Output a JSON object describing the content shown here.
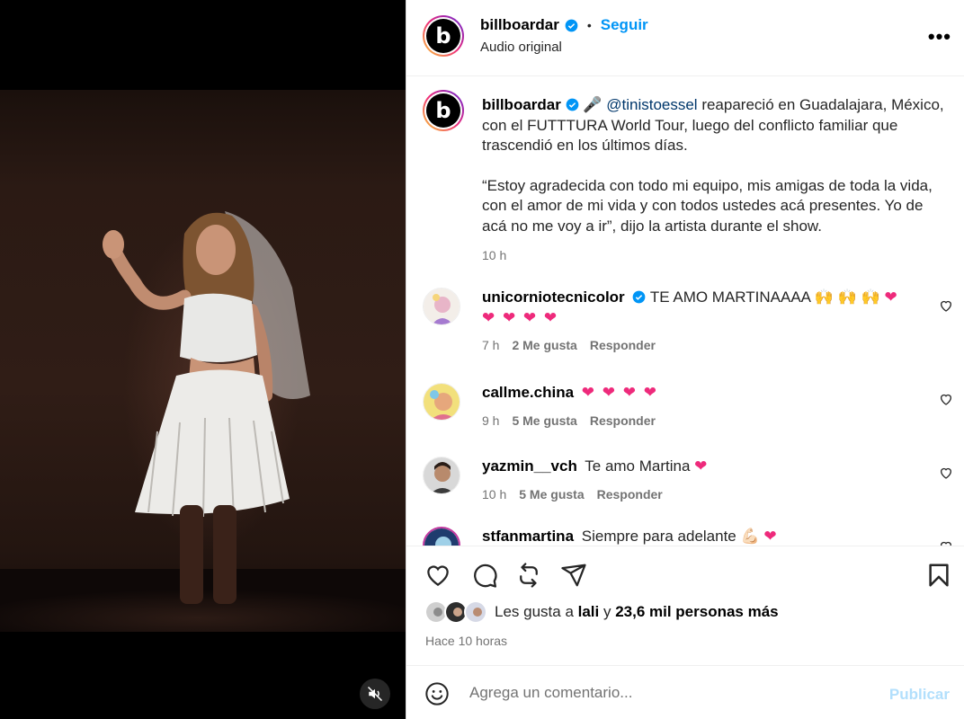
{
  "post": {
    "author": "billboardar",
    "author_avatar_letter": "b",
    "header_subtitle": "Audio original",
    "follow_label": "Seguir",
    "more_label": "•••",
    "caption": {
      "mention": "@tinistoessel",
      "text_1": " reapareció en Guadalajara, México, con el FUTTTURA World Tour, luego del conflicto familiar que trascendió en los últimos días.",
      "text_2": "“Estoy agradecida con todo mi equipo, mis amigas de toda la vida, con el amor de mi vida y con todos ustedes acá presentes. Yo de acá no me voy a ir”, dijo la artista durante el show.",
      "emoji": "🎤",
      "time": "10 h"
    }
  },
  "comments": [
    {
      "user": "unicorniotecnicolor",
      "verified": true,
      "text": "TE AMO MARTINAAAA 🙌 🙌 🙌",
      "hearts": "❤ ❤ ❤ ❤ ❤",
      "time": "7 h",
      "likes": "2 Me gusta",
      "reply": "Responder"
    },
    {
      "user": "callme.china",
      "verified": false,
      "text": "",
      "hearts": "❤ ❤ ❤ ❤",
      "time": "9 h",
      "likes": "5 Me gusta",
      "reply": "Responder"
    },
    {
      "user": "yazmin__vch",
      "verified": false,
      "text": "Te amo Martina",
      "hearts": "❤",
      "time": "10 h",
      "likes": "5 Me gusta",
      "reply": "Responder"
    },
    {
      "user": "stfanmartina",
      "verified": false,
      "text": "Siempre para adelante 💪🏻",
      "hearts": "❤",
      "time": "",
      "likes": "",
      "reply": ""
    }
  ],
  "likes": {
    "prefix": "Les gusta a ",
    "user": "lali",
    "mid": " y ",
    "count": "23,6 mil personas más"
  },
  "posted_ago": "Hace 10 horas",
  "add_comment": {
    "placeholder": "Agrega un comentario...",
    "publish_label": "Publicar"
  },
  "colors": {
    "accent": "#0095f6",
    "heart": "#ee2a7b",
    "publish_disabled": "#b2dffc"
  },
  "icons": [
    "heart-icon",
    "comment-icon",
    "repost-icon",
    "share-icon",
    "bookmark-icon",
    "emoji-icon",
    "mute-icon",
    "verified-icon"
  ]
}
